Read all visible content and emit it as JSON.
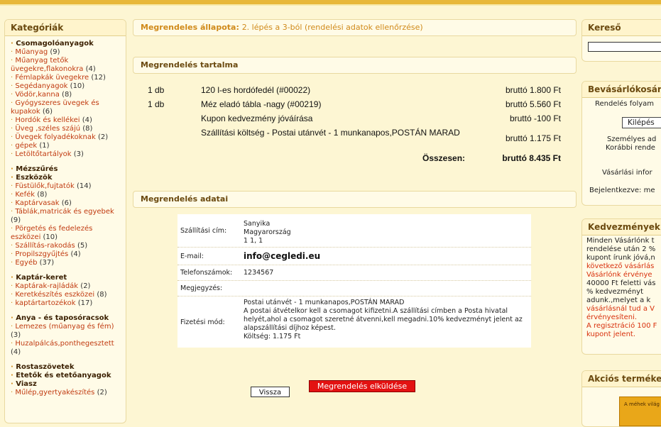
{
  "sidebar": {
    "title": "Kategóriák",
    "groups": [
      {
        "label": "Csomagolóanyagok",
        "items": [
          {
            "label": "Műanyag",
            "count": "(9)"
          },
          {
            "label": "Műanyag tetők üvegekre,flakonokra",
            "count": "(4)"
          },
          {
            "label": "Fémlapkák üvegekre",
            "count": "(12)"
          },
          {
            "label": "Segédanyagok",
            "count": "(10)"
          },
          {
            "label": "Vödör,kanna",
            "count": "(8)"
          },
          {
            "label": "Gyógyszeres üvegek és kupakok",
            "count": "(6)"
          },
          {
            "label": "Hordók és kellékei",
            "count": "(4)"
          },
          {
            "label": "Üveg ,széles szájú",
            "count": "(8)"
          },
          {
            "label": "Üvegek folyadékoknak",
            "count": "(2)"
          },
          {
            "label": "gépek",
            "count": "(1)"
          },
          {
            "label": "Letöltőtartályok",
            "count": "(3)"
          }
        ]
      },
      {
        "label": "Mézszűrés",
        "items": []
      },
      {
        "label": "Eszközök",
        "items": [
          {
            "label": "Füstülők,fujtatók",
            "count": "(14)"
          },
          {
            "label": "Kefék",
            "count": "(8)"
          },
          {
            "label": "Kaptárvasak",
            "count": "(6)"
          },
          {
            "label": "Táblák,matricák és egyebek",
            "count": "(9)"
          },
          {
            "label": "Pörgetés és fedelezés eszközei",
            "count": "(10)"
          },
          {
            "label": "Szállítás-rakodás",
            "count": "(5)"
          },
          {
            "label": "Propilszgyűjtés",
            "count": "(4)"
          },
          {
            "label": "Egyéb",
            "count": "(37)"
          }
        ]
      },
      {
        "label": "Kaptár-keret",
        "items": [
          {
            "label": "Kaptárak-rajládák",
            "count": "(2)"
          },
          {
            "label": "Keretkészítés eszközei",
            "count": "(8)"
          },
          {
            "label": "kaptártartozékok",
            "count": "(17)"
          }
        ]
      },
      {
        "label": "Anya - és taposóracsok",
        "items": [
          {
            "label": "Lemezes (műanyag és fém)",
            "count": "(3)"
          },
          {
            "label": "Huzalpálcás,ponthegesztett",
            "count": "(4)"
          }
        ]
      },
      {
        "label": "Rostaszövetek",
        "items": []
      },
      {
        "label": "Etetők és etetőanyagok",
        "items": []
      },
      {
        "label": "Viasz",
        "items": [
          {
            "label": "Műlép,gyertyakészítés",
            "count": "(2)"
          }
        ]
      }
    ]
  },
  "status": {
    "label": "Megrendeles állapota:",
    "value": "2. lépés a 3-ból (rendelési adatok ellenőrzése)"
  },
  "content": {
    "title": "Megrendelés tartalma",
    "rows": [
      {
        "qty": "1 db",
        "name": "120 l-es hordófedél (#00022)",
        "price": "bruttó 1.800 Ft"
      },
      {
        "qty": "1 db",
        "name": "Méz eladó tábla -nagy (#00219)",
        "price": "bruttó 5.560 Ft"
      },
      {
        "qty": "",
        "name": "Kupon kedvezmény jóváírása",
        "price": "bruttó -100 Ft"
      },
      {
        "qty": "",
        "name": "Szállítási költség - Postai utánvét - 1 munkanapos,POSTÁN MARAD",
        "price": "bruttó 1.175 Ft"
      }
    ],
    "total_label": "Összesen:",
    "total_value": "bruttó 8.435 Ft"
  },
  "details": {
    "title": "Megrendelés adatai",
    "shipping_label": "Szállítási cím:",
    "shipping_lines": [
      "Sanyika",
      "Magyarország",
      "1 1, 1"
    ],
    "email_label": "E-mail:",
    "email_value": "info@cegledi.eu",
    "phone_label": "Telefonszámok:",
    "phone_value": "1234567",
    "notes_label": "Megjegyzés:",
    "notes_value": "",
    "payment_label": "Fizetési mód:",
    "payment_lines": [
      "Postai utánvét - 1 munkanapos,POSTÁN MARAD",
      "A postai átvételkor kell a csomagot kifizetni.A szállítási címben a Posta hivatal helyét,ahol a csomagot szeretné átvenni,kell megadni.10% kedvezményt jelent az alapszállítási díjhoz képest.",
      "Költség: 1.175 Ft"
    ]
  },
  "buttons": {
    "back": "Vissza",
    "submit": "Megrendelés elküldése"
  },
  "right": {
    "search_title": "Kereső",
    "cart_title": "Bevásárlókosár",
    "cart_lines": [
      "Rendelés folyam",
      "Személyes ad",
      "Korábbi rende",
      "Vásárlási infor",
      "Bejelentkezve: me"
    ],
    "logout_label": "Kilépés",
    "discount_title": "Kedvezmények t",
    "discount_text": [
      {
        "t": "Minden Vásárlónk t",
        "hl": false
      },
      {
        "t": "rendelése után 2 %",
        "hl": false
      },
      {
        "t": "kupont írunk jóvá,n",
        "hl": false
      },
      {
        "t": "következő vásárlás",
        "hl": true
      },
      {
        "t": "Vásárlónk érvénye",
        "hl": true
      },
      {
        "t": "40000 Ft feletti vás",
        "hl": false
      },
      {
        "t": "% kedvezményt",
        "hl": false
      },
      {
        "t": "adunk.,melyet a k",
        "hl": false
      },
      {
        "t": "vásárlásnál tud a V",
        "hl": true
      },
      {
        "t": "érvényesíteni.",
        "hl": true
      },
      {
        "t": "A regisztráció 100 F",
        "hl": true
      },
      {
        "t": "kupont jelent.",
        "hl": true
      }
    ],
    "sale_title": "Akciós terméke",
    "sale_book_text": "A méhek világ"
  },
  "colors": {
    "accent": "#d08a1a",
    "link": "#c03a10",
    "submit": "#e31212",
    "background": "#fdf6d3"
  }
}
